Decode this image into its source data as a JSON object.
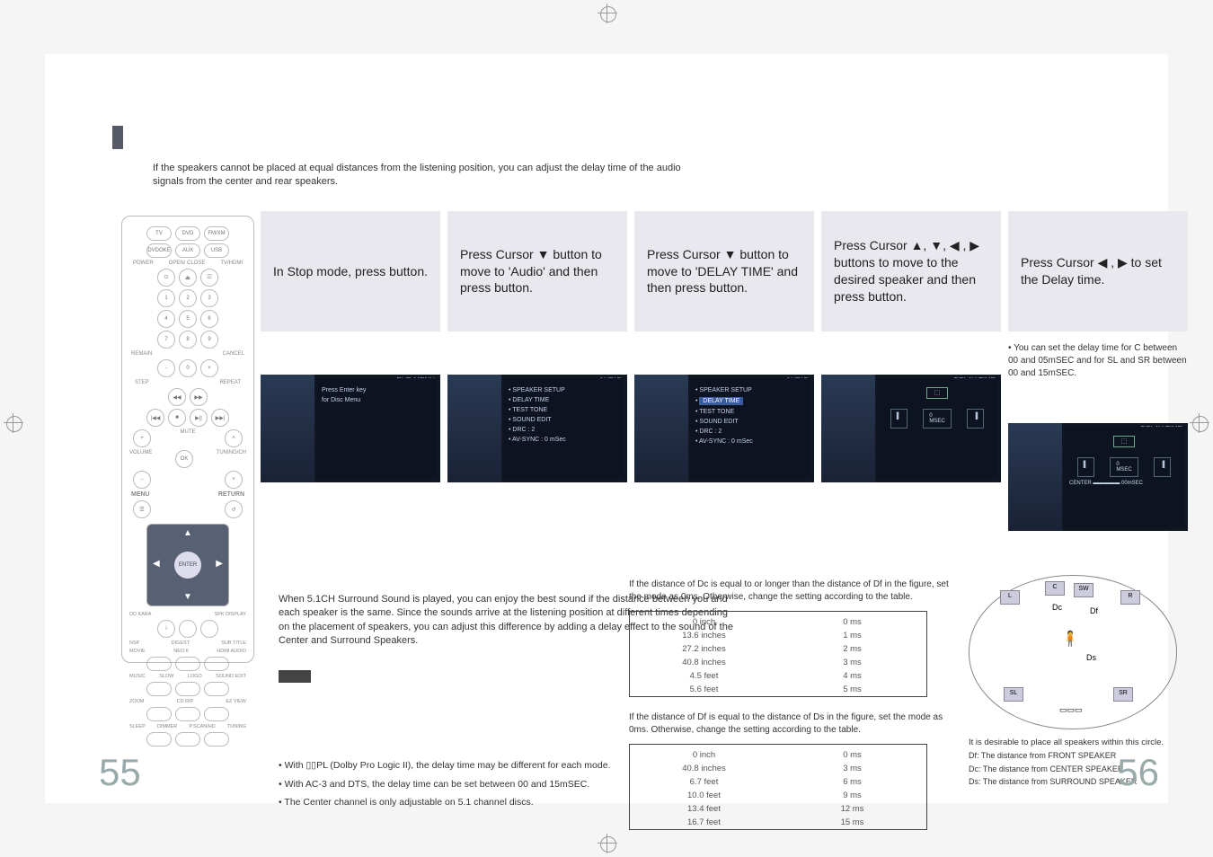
{
  "intro": "If the speakers cannot be placed at equal distances from the listening position, you can adjust the delay time of the audio signals from the center and rear speakers.",
  "steps": [
    {
      "head": "In Stop mode, press            button.",
      "screen": {
        "title": "DVD MENU",
        "lines": [
          "Press Enter key",
          "for Disc Menu"
        ]
      }
    },
    {
      "head": "Press Cursor ▼ button to move to 'Audio' and then press            button.",
      "screen": {
        "title": "AUDIO",
        "lines": [
          "• SPEAKER SETUP",
          "• DELAY TIME",
          "• TEST TONE",
          "• SOUND EDIT",
          "• DRC            : 2",
          "• AV-SYNC    : 0 mSec"
        ]
      }
    },
    {
      "head": "Press Cursor ▼ button to move to 'DELAY TIME' and then press            button.",
      "screen": {
        "title": "AUDIO",
        "lines": [
          "• SPEAKER SETUP",
          "<hl>DELAY TIME</hl>",
          "• TEST TONE",
          "• SOUND EDIT",
          "• DRC            : 2",
          "• AV-SYNC    : 0 mSec"
        ]
      }
    },
    {
      "head": "Press Cursor ▲, ▼, ◀ , ▶ buttons to move to the desired speaker and then press            button.",
      "screen": {
        "title": "DELAY TIME",
        "lines": []
      },
      "isDelayGrid": true
    },
    {
      "head": "Press Cursor ◀ , ▶ to set the Delay time.",
      "note": "• You can set the delay time for C between 00 and 05mSEC and for SL and SR between 00 and 15mSEC.",
      "screen": {
        "title": "DELAY TIME",
        "lines": []
      },
      "isDelayGrid": true
    }
  ],
  "lower_paragraph": "When 5.1CH Surround Sound is played, you can enjoy the best sound if the distance between you and each speaker is the same. Since the sounds arrive at the listening position at different times depending on the placement of speakers, you can adjust this difference by adding a delay effect to the sound of the Center and Surround Speakers.",
  "bullets": [
    "With ▯▯PL  (Dolby Pro Logic II), the delay time may be different for each mode.",
    "With AC-3 and DTS, the delay time can be set between 00 and 15mSEC.",
    "The Center channel is only adjustable on 5.1 channel discs."
  ],
  "center_text_1": "If the distance of Dc is equal to or longer than the distance of Df in the figure, set the mode as 0ms. Otherwise, change the setting according to the table.",
  "table1": [
    [
      "0 inch",
      "0 ms"
    ],
    [
      "13.6 inches",
      "1 ms"
    ],
    [
      "27.2 inches",
      "2 ms"
    ],
    [
      "40.8 inches",
      "3 ms"
    ],
    [
      "4.5 feet",
      "4 ms"
    ],
    [
      "5.6 feet",
      "5 ms"
    ]
  ],
  "center_text_2": "If the distance of Df is equal to the distance of Ds in the figure, set the mode as 0ms. Otherwise, change the setting according to the table.",
  "table2": [
    [
      "0 inch",
      "0 ms"
    ],
    [
      "40.8 inches",
      "3 ms"
    ],
    [
      "6.7 feet",
      "6 ms"
    ],
    [
      "10.0 feet",
      "9 ms"
    ],
    [
      "13.4 feet",
      "12 ms"
    ],
    [
      "16.7 feet",
      "15 ms"
    ]
  ],
  "diagram": {
    "caption": "It is desirable to place all speakers within this circle.",
    "legend": [
      "Df: The distance from FRONT SPEAKER",
      "Dc: The distance from CENTER SPEAKER",
      "Ds: The distance from SURROUND SPEAKER"
    ],
    "speakers": [
      "L",
      "C",
      "SW",
      "R",
      "SL",
      "SR"
    ],
    "dists": [
      "Dc",
      "Df",
      "Ds"
    ]
  },
  "remote": {
    "top_row": [
      "TV",
      "DVD",
      "FM/XM"
    ],
    "top_row2": [
      "DVDOKE",
      "AUX",
      "USB"
    ],
    "labels": {
      "power": "POWER",
      "open": "OPEN/\nCLOSE",
      "hdmi": "TV/HDMI",
      "remain": "REMAIN",
      "cancel": "CANCEL",
      "step": "STEP",
      "repeat": "REPEAT",
      "vol": "VOLUME",
      "mute": "MUTE",
      "tuning": "TUNING/CH",
      "menu": "MENU",
      "return": "RETURN",
      "enter": "ENTER",
      "info": "INFO",
      "ddkar": "DD KARA",
      "nsp": "NSP",
      "neo": "NEO:6",
      "hdmiA": "HDMI AUDIO",
      "movie": "MOVIE",
      "music": "MUSIC",
      "slow": "SLOW",
      "logo": "LOGO",
      "se": "SOUND EDIT",
      "zoom": "ZOOM",
      "cdrip": "CD RIP",
      "ezv": "EZ VIEW",
      "sleep": "SLEEP",
      "dimmer": "DIMMER",
      "psc": "P.SCAN/HD",
      "tuning2": "TUNING",
      "subt": "SUB TITLE",
      "sdisp": "SPK DISPLAY",
      "dig": "DIGEST"
    }
  },
  "page_left": "55",
  "page_right": "56"
}
